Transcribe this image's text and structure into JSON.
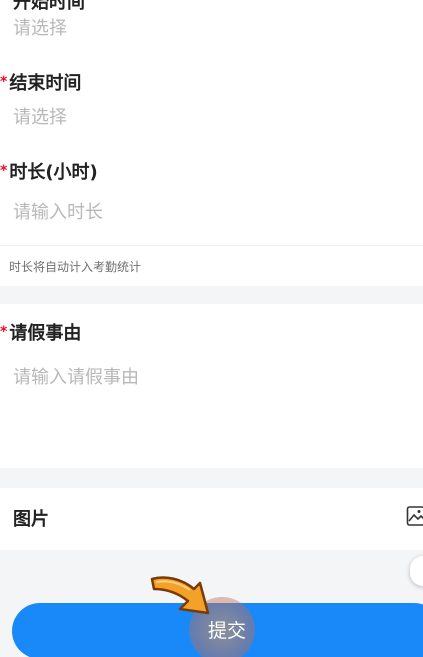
{
  "form": {
    "start_time": {
      "label": "开始时间",
      "placeholder": "请选择"
    },
    "end_time": {
      "required_mark": "*",
      "label": "结束时间",
      "placeholder": "请选择"
    },
    "duration": {
      "required_mark": "*",
      "label": "时长(小时)",
      "placeholder": "请输入时长",
      "hint": "时长将自动计入考勤统计"
    },
    "reason": {
      "required_mark": "*",
      "label": "请假事由",
      "placeholder": "请输入请假事由"
    },
    "picture": {
      "label": "图片",
      "icon": "image-upload-icon"
    }
  },
  "submit": {
    "label": "提交"
  },
  "colors": {
    "primary": "#1989fa",
    "required": "#ee0a24",
    "placeholder": "#b8b8b8",
    "background": "#f4f5f7"
  }
}
